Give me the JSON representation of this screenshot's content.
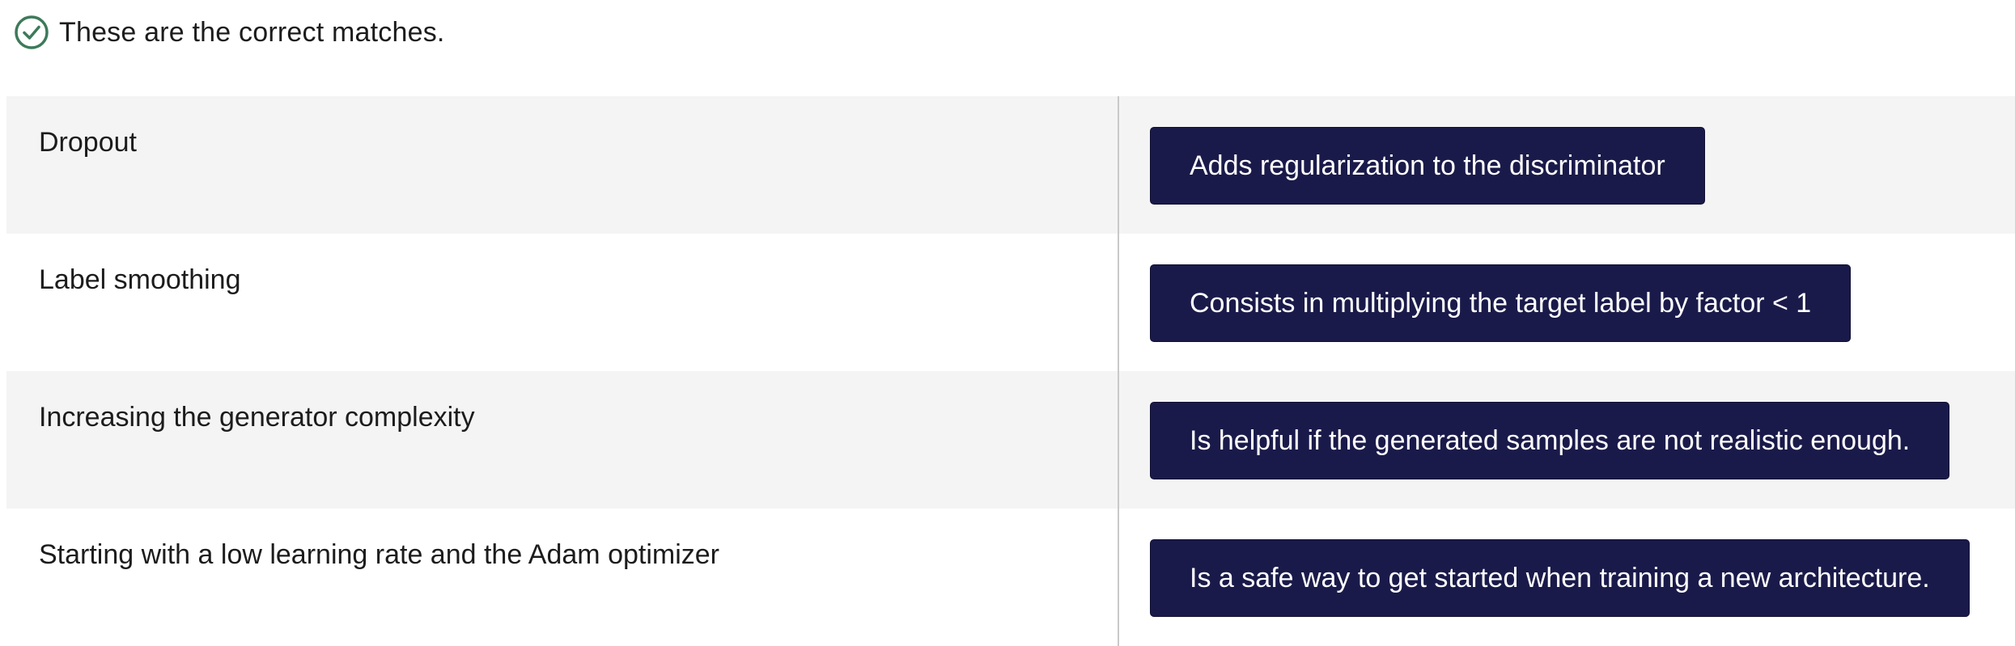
{
  "feedback": {
    "icon": "check-circle-icon",
    "icon_color": "#3d7a5a",
    "text": "These are the correct matches."
  },
  "colors": {
    "chip_background": "#1a1a4a",
    "chip_text": "#ffffff",
    "row_shaded": "#f4f4f4",
    "divider": "#c9c9c9"
  },
  "rows": [
    {
      "prompt": "Dropout",
      "answer": "Adds regularization to the discriminator"
    },
    {
      "prompt": "Label smoothing",
      "answer": "Consists in multiplying the target label by factor < 1"
    },
    {
      "prompt": "Increasing the generator complexity",
      "answer": "Is helpful if the generated samples are not realistic enough."
    },
    {
      "prompt": "Starting with a low learning rate and the Adam optimizer",
      "answer": "Is a safe way to get started when training a new architecture."
    }
  ]
}
